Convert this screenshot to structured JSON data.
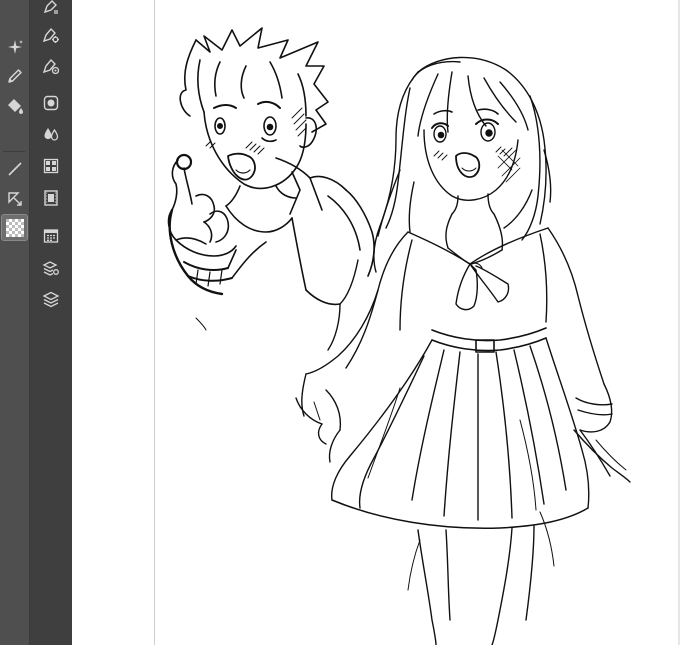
{
  "app": {
    "colors": {
      "tool_column_bg": "#4f4f4f",
      "command_column_bg": "#3f3f3f",
      "icon_color": "#d6d6d6",
      "selected_tool_bg": "#6e6e6e",
      "canvas_bg": "#ffffff",
      "ink": "#111111"
    }
  },
  "tool_palette": {
    "tools": [
      {
        "id": "sparkle",
        "icon": "sparkle-icon"
      },
      {
        "id": "pencil",
        "icon": "pencil-icon"
      },
      {
        "id": "fill",
        "icon": "fill-bucket-icon"
      },
      {
        "id": "line",
        "icon": "line-icon"
      },
      {
        "id": "transform",
        "icon": "transform-arrow-icon"
      },
      {
        "id": "transparent",
        "icon": "transparent-color-icon",
        "selected": true
      }
    ]
  },
  "command_bar": {
    "buttons": [
      {
        "id": "pen-settings",
        "icon": "pen-settings-icon"
      },
      {
        "id": "pen-gear",
        "icon": "pen-gear-icon"
      },
      {
        "id": "pen-target",
        "icon": "pen-target-icon"
      },
      {
        "id": "circle-frame",
        "icon": "circle-frame-icon"
      },
      {
        "id": "water-drops",
        "icon": "water-drops-icon"
      },
      {
        "id": "grid-panel",
        "icon": "grid-panel-icon"
      },
      {
        "id": "film",
        "icon": "film-icon"
      },
      {
        "id": "calendar",
        "icon": "calendar-grid-icon"
      },
      {
        "id": "layer-props",
        "icon": "layer-properties-icon"
      },
      {
        "id": "layers",
        "icon": "layers-icon"
      }
    ]
  },
  "canvas": {
    "subject": "sketch-boy-and-girl"
  }
}
